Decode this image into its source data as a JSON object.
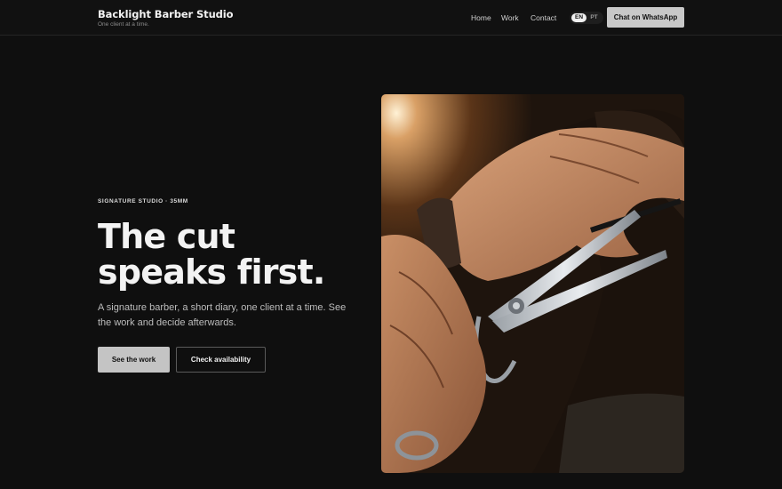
{
  "header": {
    "brand_name": "Backlight Barber Studio",
    "brand_tagline": "One client at a time.",
    "nav": [
      "Home",
      "Work",
      "Contact"
    ],
    "lang_options": [
      "EN",
      "PT"
    ],
    "lang_selected": "EN",
    "cta_label": "Chat on WhatsApp"
  },
  "hero": {
    "eyebrow": "SIGNATURE STUDIO · 35MM",
    "headline": "The cut speaks first.",
    "lede": "A signature barber, a short diary, one client at a time. See the work and decide afterwards.",
    "primary_button": "See the work",
    "secondary_button": "Check availability"
  },
  "colors": {
    "background": "#0f0f0f",
    "primary_button": "#c4c4c4",
    "text": "#f3f3f3"
  }
}
